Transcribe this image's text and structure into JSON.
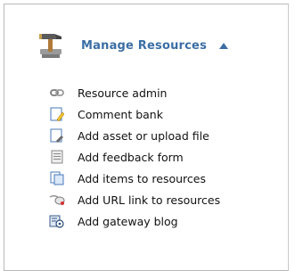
{
  "section": {
    "title": "Manage Resources",
    "header_icon": "hammer-icon",
    "toggle_icon": "collapse-up-arrow-icon"
  },
  "colors": {
    "title": "#3b6ea5",
    "text": "#111111",
    "border": "#b9b9b9"
  },
  "menu": {
    "items": [
      {
        "label": "Resource admin",
        "icon": "chain-link-icon"
      },
      {
        "label": "Comment bank",
        "icon": "document-pencil-icon"
      },
      {
        "label": "Add asset or upload file",
        "icon": "document-upload-icon"
      },
      {
        "label": "Add feedback form",
        "icon": "form-icon"
      },
      {
        "label": "Add items to resources",
        "icon": "copy-documents-icon"
      },
      {
        "label": "Add URL link to resources",
        "icon": "mouse-link-icon"
      },
      {
        "label": "Add gateway blog",
        "icon": "blog-icon"
      }
    ]
  }
}
